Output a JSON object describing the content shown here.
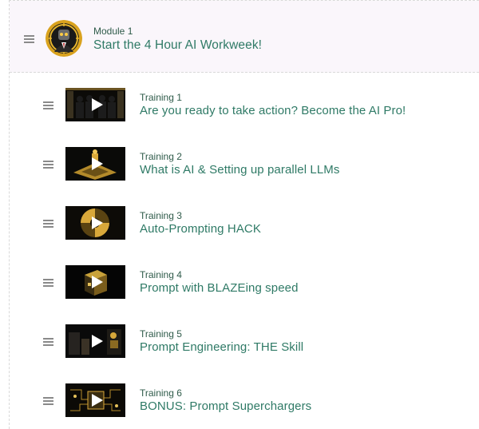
{
  "module": {
    "label": "Module 1",
    "title": "Start the 4 Hour AI Workweek!",
    "avatar_icon": "robot-avatar-icon"
  },
  "lessons": [
    {
      "label": "Training 1",
      "title": "Are you ready to take action? Become the AI Pro!"
    },
    {
      "label": "Training 2",
      "title": "What is AI & Setting up parallel LLMs"
    },
    {
      "label": "Training 3",
      "title": "Auto-Prompting HACK"
    },
    {
      "label": "Training 4",
      "title": "Prompt with BLAZEing speed"
    },
    {
      "label": "Training 5",
      "title": "Prompt Engineering: THE Skill"
    },
    {
      "label": "Training 6",
      "title": "BONUS: Prompt Superchargers"
    }
  ],
  "colors": {
    "title_green": "#2f7a66",
    "label_green": "#2f5b4a",
    "header_bg": "#faf6fb",
    "gold": "#c9a23a"
  }
}
